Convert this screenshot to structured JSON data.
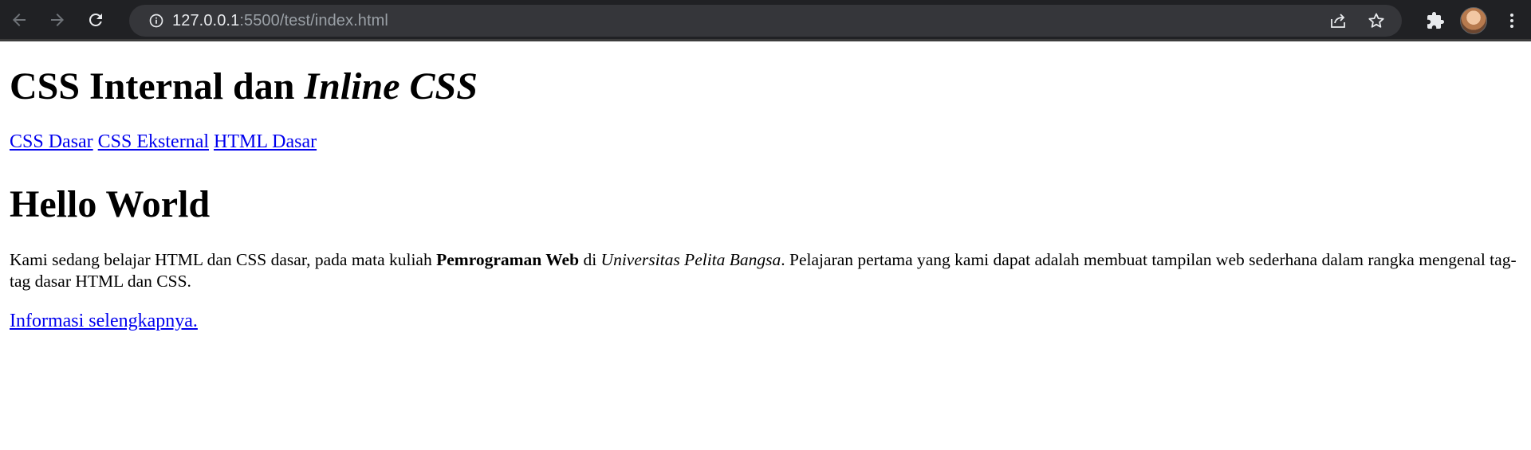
{
  "browser": {
    "url_host": "127.0.0.1",
    "url_path": ":5500/test/index.html",
    "icons": {
      "back": "back-arrow-icon",
      "forward": "forward-arrow-icon",
      "reload": "reload-icon",
      "site_info": "info-icon",
      "share": "share-icon",
      "bookmark": "star-icon",
      "extensions": "puzzle-icon",
      "profile": "avatar",
      "menu": "kebab-menu-icon"
    },
    "colors": {
      "toolbar_bg": "#202124",
      "omnibox_bg": "#35363a",
      "url_host": "#e8eaed",
      "url_path": "#9aa0a6",
      "link": "#0000ee"
    }
  },
  "page": {
    "title_plain": "CSS Internal dan ",
    "title_italic": "Inline CSS",
    "nav_links": [
      "CSS Dasar",
      "CSS Eksternal",
      "HTML Dasar"
    ],
    "heading": "Hello World",
    "paragraph": {
      "part1": "Kami sedang belajar HTML dan CSS dasar, pada mata kuliah ",
      "bold": "Pemrograman Web",
      "part2": " di ",
      "italic": "Universitas Pelita Bangsa",
      "part3": ". Pelajaran pertama yang kami dapat adalah membuat tampilan web sederhana dalam rangka mengenal tag-tag dasar HTML dan CSS."
    },
    "more_link": "Informasi selengkapnya."
  }
}
